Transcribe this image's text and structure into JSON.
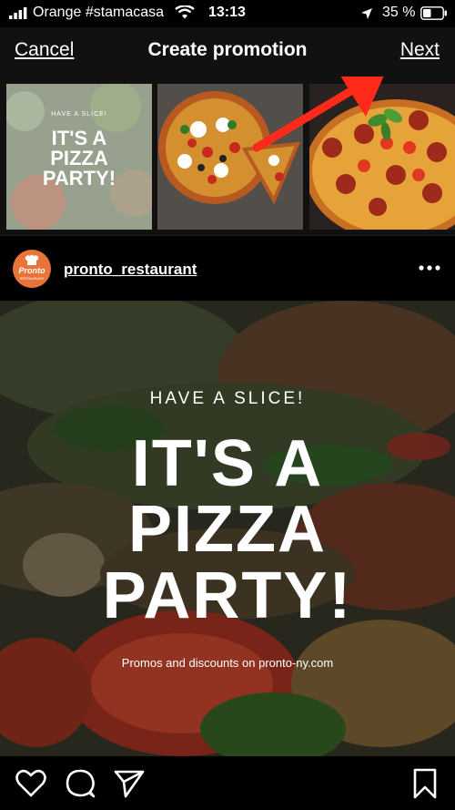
{
  "status_bar": {
    "carrier": "Orange #stamacasa",
    "time": "13:13",
    "battery": "35 %"
  },
  "nav": {
    "cancel_label": "Cancel",
    "title": "Create promotion",
    "next_label": "Next"
  },
  "thumbnails": [
    {
      "kicker": "HAVE A SLICE!",
      "headline_lines": [
        "IT'S A",
        "PIZZA",
        "PARTY!"
      ],
      "selected": true
    },
    {
      "kicker": "",
      "headline_lines": [],
      "selected": false
    },
    {
      "kicker": "",
      "headline_lines": [],
      "selected": false
    }
  ],
  "post": {
    "username": "pronto_restaurant",
    "avatar_text": "Pronto",
    "avatar_subtext": "RESTAURANT",
    "kicker": "HAVE A SLICE!",
    "headline_lines": [
      "IT'S A",
      "PIZZA",
      "PARTY!"
    ],
    "promo_text": "Promos and discounts on pronto-ny.com"
  },
  "icons": {
    "wifi": "wifi-icon",
    "battery": "battery-icon",
    "more": "more-options-icon",
    "like": "heart-icon",
    "comment": "comment-icon",
    "share": "send-icon",
    "save": "bookmark-icon",
    "annotation": "red-arrow-annotation"
  },
  "colors": {
    "arrow": "#ff2a1a",
    "avatar": "#e8743a",
    "nav_background": "#111111"
  }
}
